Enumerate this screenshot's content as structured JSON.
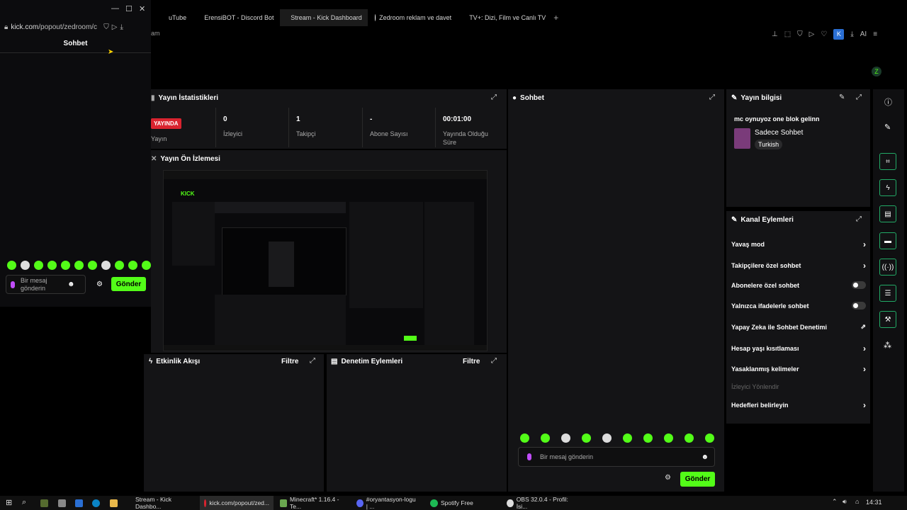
{
  "browser_tabs": [
    {
      "label": "uTube",
      "favicon_color": "#000000"
    },
    {
      "label": "ErensiBOT - Discord Bot",
      "favicon_color": "#5865f2"
    },
    {
      "label": "Stream - Kick Dashboard",
      "favicon_color": "#53fc18"
    },
    {
      "label": "Zedroom reklam ve davet",
      "favicon_color": "#ffffff"
    },
    {
      "label": "TV+: Dizi, Film ve Canlı TV",
      "favicon_color": "#ffffff"
    }
  ],
  "popout": {
    "url_host": "kick.com",
    "url_path": "/popout/zedroom/c",
    "title": "Sohbet",
    "message_placeholder": "Bir mesaj gönderin",
    "send_label": "Gönder"
  },
  "page_fragment": "am",
  "toolbar": {
    "profile_letter": "K",
    "ai_label": "AI"
  },
  "stream_stats": {
    "title": "Yayın İstatistikleri",
    "live_badge": "YAYINDA",
    "live_label": "Yayın",
    "stats": [
      {
        "value": "0",
        "label": "İzleyici"
      },
      {
        "value": "1",
        "label": "Takipçi"
      },
      {
        "value": "-",
        "label": "Abone Sayısı"
      },
      {
        "value": "00:01:00",
        "label": "Yayında Olduğu Süre"
      }
    ]
  },
  "preview": {
    "title": "Yayın Ön İzlemesi",
    "brand": "KICK"
  },
  "activity": {
    "title": "Etkinlik Akışı",
    "filter_label": "Filtre"
  },
  "moderation": {
    "title": "Denetim Eylemleri",
    "filter_label": "Filtre"
  },
  "chat": {
    "title": "Sohbet",
    "placeholder": "Bir mesaj gönderin",
    "send_label": "Gönder"
  },
  "stream_info": {
    "title": "Yayın bilgisi",
    "stream_title": "mc oynuyoz one blok gelinn",
    "category": "Sadece Sohbet",
    "language": "Turkish"
  },
  "channel_actions": {
    "title": "Kanal Eylemleri",
    "items": [
      {
        "label": "Yavaş mod",
        "control": "chevron"
      },
      {
        "label": "Takipçilere özel sohbet",
        "control": "chevron"
      },
      {
        "label": "Abonelere özel sohbet",
        "control": "toggle"
      },
      {
        "label": "Yalnızca ifadelerle sohbet",
        "control": "toggle"
      },
      {
        "label": "Yapay Zeka ile Sohbet Denetimi",
        "control": "external"
      },
      {
        "label": "Hesap yaşı kısıtlaması",
        "control": "chevron"
      },
      {
        "label": "Yasaklanmış kelimeler",
        "control": "chevron"
      }
    ],
    "section_label": "İzleyici Yönlendir",
    "goals_label": "Hedefleri belirleyin"
  },
  "taskbar": {
    "items": [
      {
        "label": "Stream - Kick Dashbo...",
        "icon_color": "#53fc18"
      },
      {
        "label": "kick.com/popout/zed...",
        "icon_color": "#d9232f"
      },
      {
        "label": "Minecraft* 1.16.4 - Te...",
        "icon_color": "#6aa84f"
      },
      {
        "label": "#oryantasyon-logu | ...",
        "icon_color": "#5865f2"
      },
      {
        "label": "Spotify Free",
        "icon_color": "#1db954"
      },
      {
        "label": "OBS 32.0.4 - Profil: İsi...",
        "icon_color": "#dddddd"
      }
    ],
    "clock": "14:31"
  },
  "colors": {
    "accent": "#53fc18",
    "live": "#d9232f",
    "panel": "#141416"
  }
}
